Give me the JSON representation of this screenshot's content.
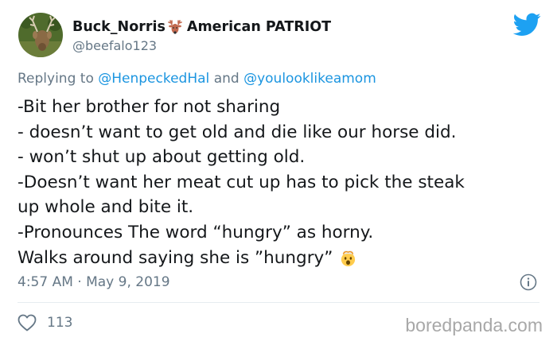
{
  "user": {
    "display_name": "Buck_Norris",
    "display_name_suffix": "American PATRIOT",
    "handle": "@beefalo123",
    "name_emoji": "deer-emoji"
  },
  "reply": {
    "prefix": "Replying to",
    "mention1": "@HenpeckedHal",
    "joiner": "and",
    "mention2": "@youlooklikeamom"
  },
  "tweet": {
    "lines": [
      "-Bit her brother for not sharing",
      "- doesn’t want to get old and die like our horse did.",
      "- won’t shut up about getting old.",
      "-Doesn’t want her meat cut up has to pick the steak",
      "up whole and bite it.",
      "-Pronounces The word “hungry” as horny.",
      "Walks around saying she is ”hungry”"
    ],
    "end_emoji": "exploding-head-emoji",
    "timestamp": "4:57 AM · May 9, 2019"
  },
  "actions": {
    "like_count": "113"
  },
  "watermark": "boredpanda.com",
  "colors": {
    "twitter_blue": "#1da1f2",
    "mention_blue": "#1b95e0",
    "secondary_text": "#657786",
    "divider": "#e6ecf0"
  }
}
